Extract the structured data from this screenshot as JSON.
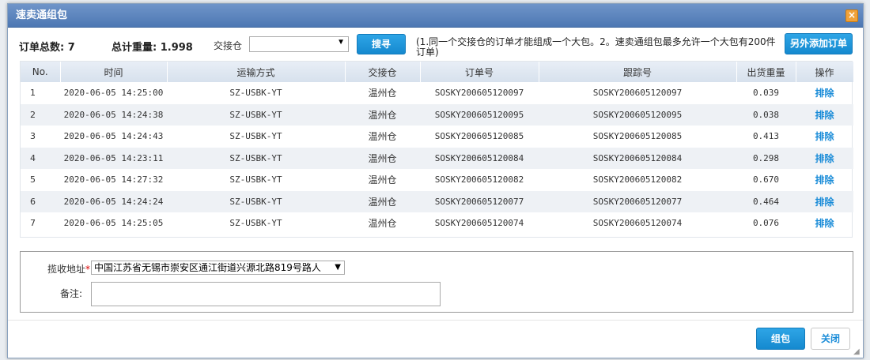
{
  "dialog": {
    "title": "速卖通组包",
    "close_glyph": "×"
  },
  "toolbar": {
    "total_orders_label": "订单总数: 7",
    "total_weight_label": "总计重量: 1.998",
    "warehouse_label": "交接仓",
    "warehouse_value": "",
    "search_label": "搜寻",
    "note": "(1.同一个交接仓的订单才能组成一个大包。2。速卖通组包最多允许一个大包有200件订单)",
    "add_order_label": "另外添加订单"
  },
  "table": {
    "columns": [
      "No.",
      "时间",
      "运输方式",
      "交接仓",
      "订单号",
      "跟踪号",
      "出货重量",
      "操作"
    ],
    "rows": [
      {
        "no": "1",
        "time": "2020-06-05 14:25:00",
        "method": "SZ-USBK-YT",
        "warehouse": "温州仓",
        "order": "SOSKY200605120097",
        "tracking": "SOSKY200605120097",
        "weight": "0.039",
        "action": "排除"
      },
      {
        "no": "2",
        "time": "2020-06-05 14:24:38",
        "method": "SZ-USBK-YT",
        "warehouse": "温州仓",
        "order": "SOSKY200605120095",
        "tracking": "SOSKY200605120095",
        "weight": "0.038",
        "action": "排除"
      },
      {
        "no": "3",
        "time": "2020-06-05 14:24:43",
        "method": "SZ-USBK-YT",
        "warehouse": "温州仓",
        "order": "SOSKY200605120085",
        "tracking": "SOSKY200605120085",
        "weight": "0.413",
        "action": "排除"
      },
      {
        "no": "4",
        "time": "2020-06-05 14:23:11",
        "method": "SZ-USBK-YT",
        "warehouse": "温州仓",
        "order": "SOSKY200605120084",
        "tracking": "SOSKY200605120084",
        "weight": "0.298",
        "action": "排除"
      },
      {
        "no": "5",
        "time": "2020-06-05 14:27:32",
        "method": "SZ-USBK-YT",
        "warehouse": "温州仓",
        "order": "SOSKY200605120082",
        "tracking": "SOSKY200605120082",
        "weight": "0.670",
        "action": "排除"
      },
      {
        "no": "6",
        "time": "2020-06-05 14:24:24",
        "method": "SZ-USBK-YT",
        "warehouse": "温州仓",
        "order": "SOSKY200605120077",
        "tracking": "SOSKY200605120077",
        "weight": "0.464",
        "action": "排除"
      },
      {
        "no": "7",
        "time": "2020-06-05 14:25:05",
        "method": "SZ-USBK-YT",
        "warehouse": "温州仓",
        "order": "SOSKY200605120074",
        "tracking": "SOSKY200605120074",
        "weight": "0.076",
        "action": "排除"
      }
    ]
  },
  "form": {
    "address_label": "揽收地址",
    "required_mark": "*",
    "address_value": "中国江苏省无锡市崇安区通江街道兴源北路819号路人",
    "remark_label": "备注:",
    "remark_value": ""
  },
  "footer": {
    "pack_label": "组包",
    "close_label": "关闭"
  },
  "colors": {
    "title_bar": "#4d78b3",
    "primary_button": "#1589cf",
    "link": "#1a8cd8"
  }
}
